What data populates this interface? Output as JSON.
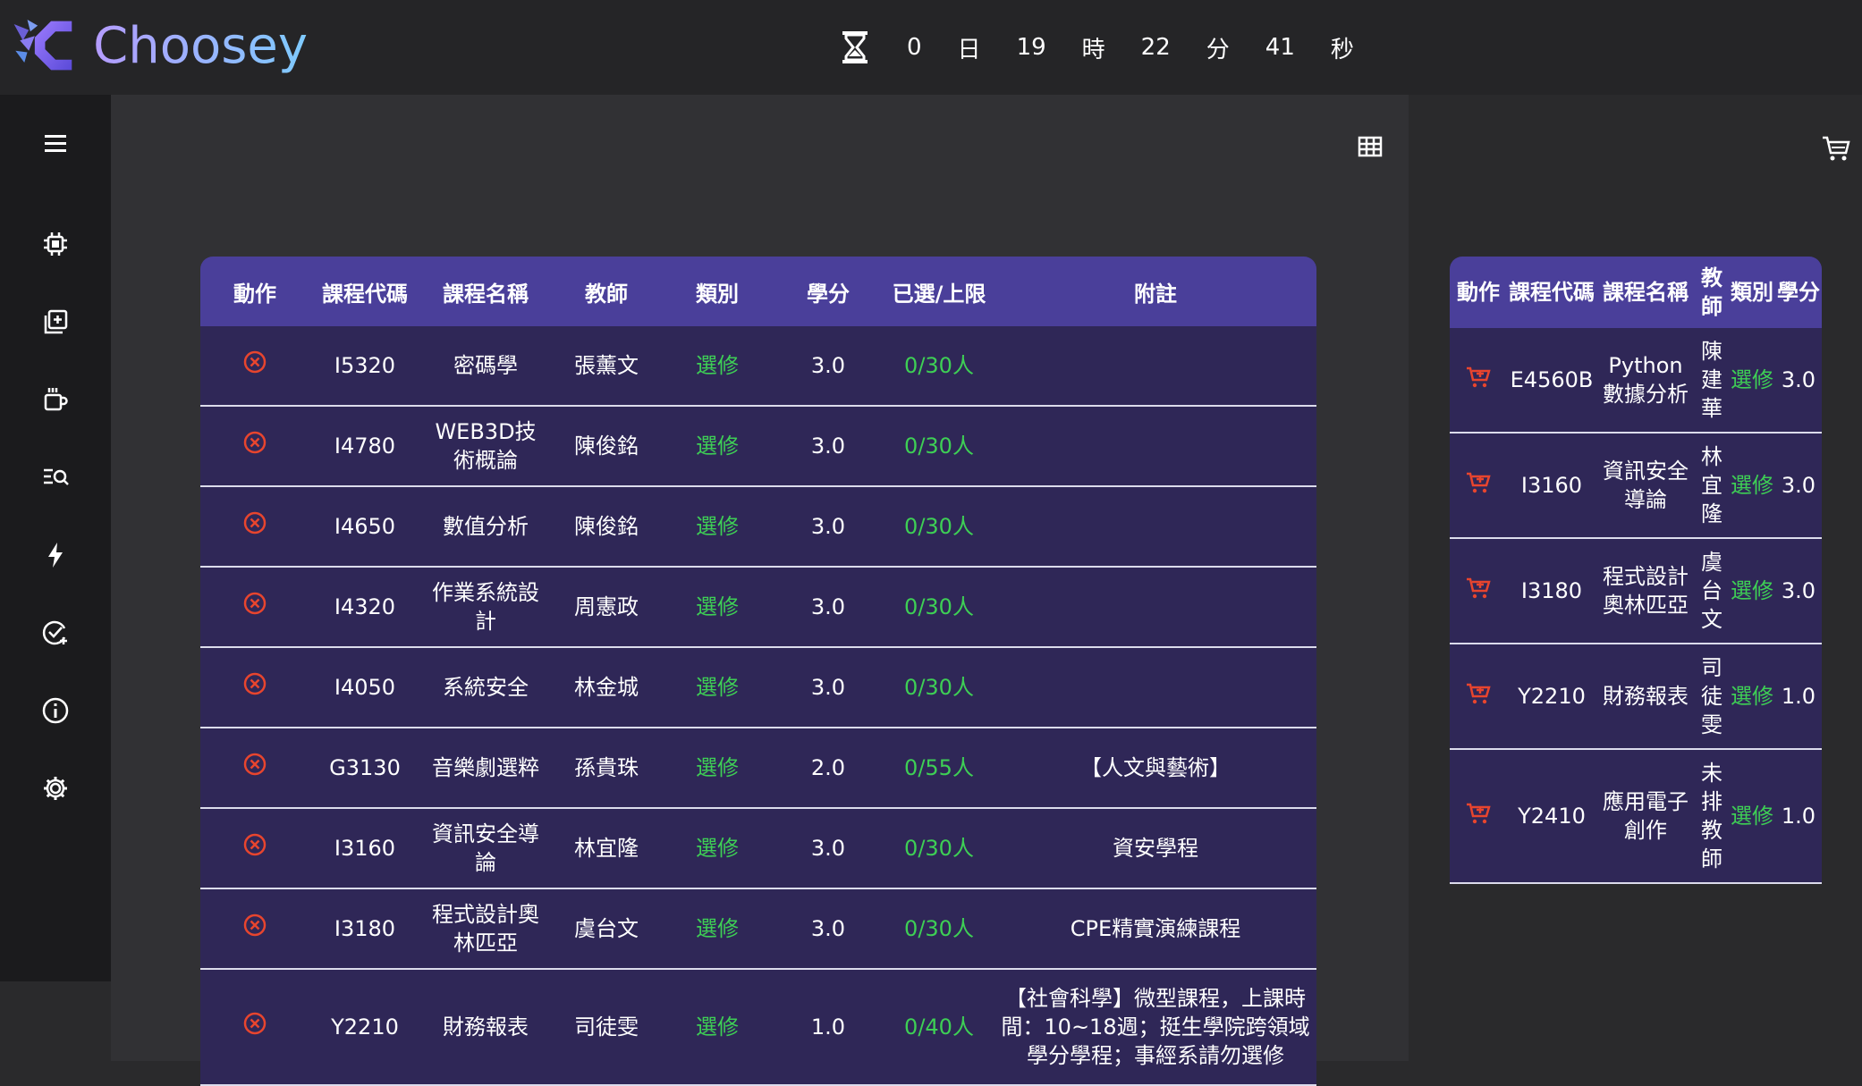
{
  "app": {
    "name": "Choosey"
  },
  "colors": {
    "accent": "#4a3f9a",
    "row_bg": "#2f2757",
    "green": "#3ecf55",
    "red": "#e8452e"
  },
  "countdown": {
    "days": "0",
    "days_unit": "日",
    "hours": "19",
    "hours_unit": "時",
    "minutes": "22",
    "minutes_unit": "分",
    "seconds": "41",
    "seconds_unit": "秒"
  },
  "sidebar": {
    "icons": [
      "menu-icon",
      "chip-icon",
      "add-course-icon",
      "coffee-icon",
      "search-list-icon",
      "flash-icon",
      "check-add-icon",
      "info-icon",
      "gear-icon"
    ]
  },
  "main_table": {
    "headers": [
      "動作",
      "課程代碼",
      "課程名稱",
      "教師",
      "類別",
      "學分",
      "已選/上限",
      "附註"
    ],
    "rows": [
      {
        "code": "I5320",
        "name": "密碼學",
        "teacher": "張薰文",
        "type": "選修",
        "credit": "3.0",
        "enroll": "0/30人",
        "note": ""
      },
      {
        "code": "I4780",
        "name": "WEB3D技術概論",
        "teacher": "陳俊銘",
        "type": "選修",
        "credit": "3.0",
        "enroll": "0/30人",
        "note": ""
      },
      {
        "code": "I4650",
        "name": "數值分析",
        "teacher": "陳俊銘",
        "type": "選修",
        "credit": "3.0",
        "enroll": "0/30人",
        "note": ""
      },
      {
        "code": "I4320",
        "name": "作業系統設計",
        "teacher": "周憲政",
        "type": "選修",
        "credit": "3.0",
        "enroll": "0/30人",
        "note": ""
      },
      {
        "code": "I4050",
        "name": "系統安全",
        "teacher": "林金城",
        "type": "選修",
        "credit": "3.0",
        "enroll": "0/30人",
        "note": ""
      },
      {
        "code": "G3130",
        "name": "音樂劇選粹",
        "teacher": "孫貴珠",
        "type": "選修",
        "credit": "2.0",
        "enroll": "0/55人",
        "note": "【人文與藝術】"
      },
      {
        "code": "I3160",
        "name": "資訊安全導論",
        "teacher": "林宜隆",
        "type": "選修",
        "credit": "3.0",
        "enroll": "0/30人",
        "note": "資安學程"
      },
      {
        "code": "I3180",
        "name": "程式設計奧林匹亞",
        "teacher": "虞台文",
        "type": "選修",
        "credit": "3.0",
        "enroll": "0/30人",
        "note": "CPE精實演練課程"
      },
      {
        "code": "Y2210",
        "name": "財務報表",
        "teacher": "司徒雯",
        "type": "選修",
        "credit": "1.0",
        "enroll": "0/40人",
        "note": "【社會科學】微型課程，上課時間：10~18週；挺生學院跨領域學分學程；事經系請勿選修"
      }
    ]
  },
  "cart_table": {
    "headers": [
      "動作",
      "課程代碼",
      "課程名稱",
      "教師",
      "類別",
      "學分"
    ],
    "rows": [
      {
        "code": "E4560B",
        "name": "Python數據分析",
        "teacher": "陳建華",
        "type": "選修",
        "credit": "3.0"
      },
      {
        "code": "I3160",
        "name": "資訊安全導論",
        "teacher": "林宜隆",
        "type": "選修",
        "credit": "3.0"
      },
      {
        "code": "I3180",
        "name": "程式設計奧林匹亞",
        "teacher": "虞台文",
        "type": "選修",
        "credit": "3.0"
      },
      {
        "code": "Y2210",
        "name": "財務報表",
        "teacher": "司徒雯",
        "type": "選修",
        "credit": "1.0"
      },
      {
        "code": "Y2410",
        "name": "應用電子創作",
        "teacher": "未排教師",
        "type": "選修",
        "credit": "1.0"
      }
    ]
  }
}
